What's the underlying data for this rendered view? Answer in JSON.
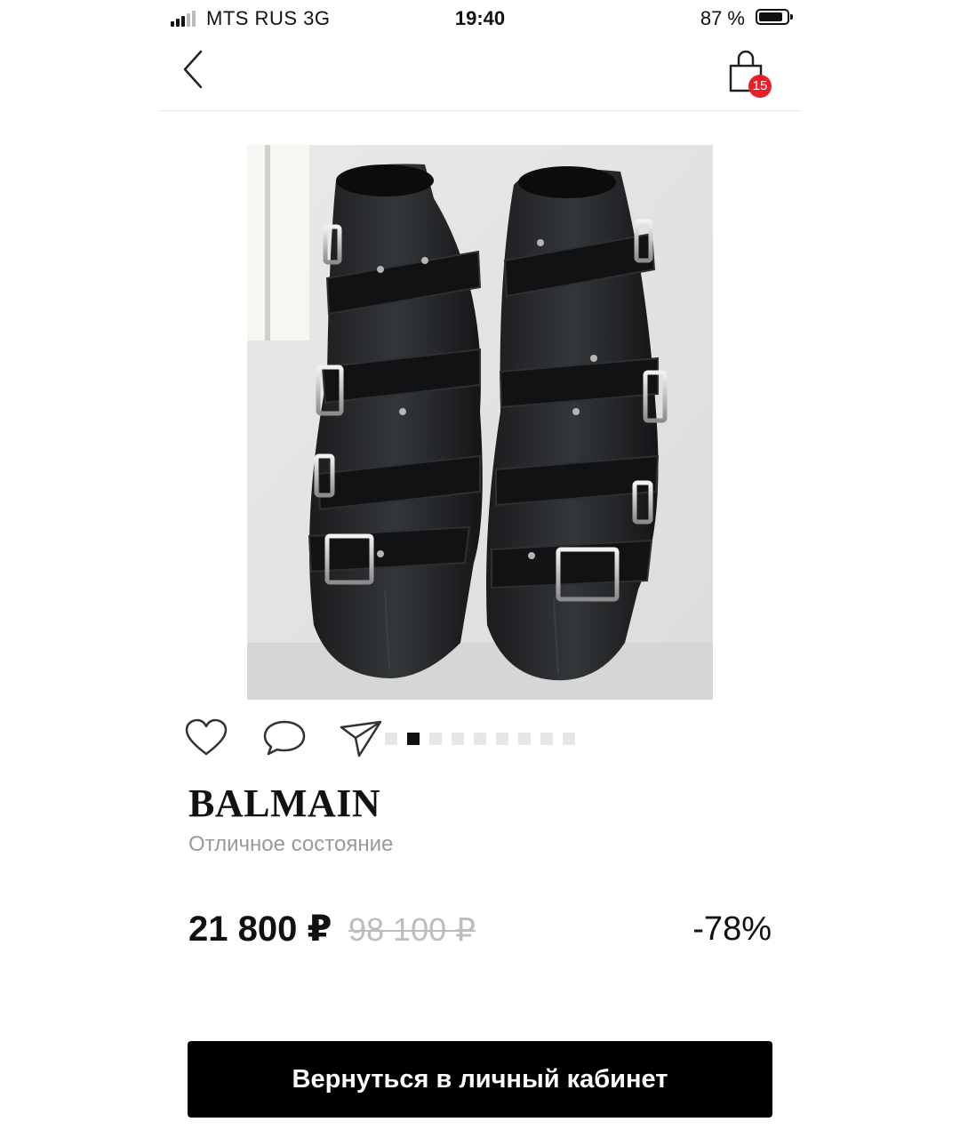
{
  "status_bar": {
    "carrier": "MTS RUS   3G",
    "time": "19:40",
    "battery_text": "87 %",
    "battery_level": 0.87,
    "signal_bars_active": 3,
    "signal_bars_total": 5
  },
  "nav": {
    "back_icon": "chevron-left-icon",
    "cart_icon": "shopping-bag-icon",
    "cart_count": "15",
    "badge_color": "#e8202a"
  },
  "gallery": {
    "slide_count": 9,
    "active_slide": 2
  },
  "actions": {
    "like_icon": "heart-icon",
    "comment_icon": "comment-icon",
    "share_icon": "send-icon"
  },
  "product": {
    "brand": "BALMAIN",
    "condition": "Отличное состояние",
    "price": "21 800 ₽",
    "old_price": "98 100 ₽",
    "discount": "-78%"
  },
  "cta": {
    "label": "Вернуться в личный кабинет"
  }
}
